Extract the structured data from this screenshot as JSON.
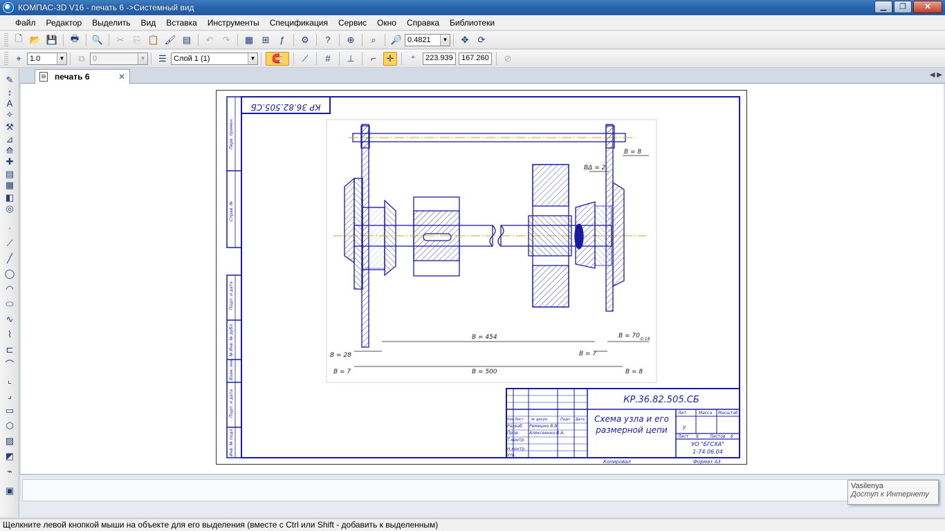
{
  "window": {
    "title": "КОМПАС-3D V16  - печать 6 ->Системный вид",
    "minimize": "▁",
    "maximize": "❐",
    "close": "✕"
  },
  "menu": [
    "Файл",
    "Редактор",
    "Выделить",
    "Вид",
    "Вставка",
    "Инструменты",
    "Спецификация",
    "Сервис",
    "Окно",
    "Справка",
    "Библиотеки"
  ],
  "toolbar1": {
    "zoom_value": "0.4821"
  },
  "toolbar2": {
    "line_scale": "1.0",
    "style_value": "0",
    "layer": "Слой 1 (1)",
    "coord_x": "223.939",
    "coord_y": "167.260"
  },
  "tab": {
    "label": "печать 6",
    "close": "✕",
    "scroll": "◀ ▶"
  },
  "drawing": {
    "stamp_top": "КР 36.82.505.СБ",
    "title_code": "КР.36.82.505.СБ",
    "title_name_line1": "Схема узла и его",
    "title_name_line2": "размерной цепи",
    "org_line1": "УО \"БГСХА\"",
    "org_line2": "1-74 06.04",
    "copied": "Копировал",
    "format": "Формат   А3",
    "lit": "Лит.",
    "mass": "Масса",
    "scale": "Масштаб",
    "sheet": "Лист",
    "sheets": "Листов",
    "sheet_num": "6",
    "sheets_num": "6",
    "lit_u": "у",
    "row_labels": [
      "Изм.",
      "Лист",
      "№ докум.",
      "Подп.",
      "Дата"
    ],
    "roles": [
      "Разраб.",
      "Пров.",
      "Т.контр.",
      "Н.контр.",
      "Утв."
    ],
    "developer": "Ремешко В.В.",
    "checker": "Алексеенко В.А.",
    "side_labels": [
      "Перв. примен.",
      "Справ. №",
      "Подп. и дата",
      "Инв. № дубл.",
      "Взам. инв. №",
      "Подп. и дата",
      "Инв. № подл."
    ],
    "dims": {
      "b_ku_8": "В = 8",
      "b_delta": "ВΔ = 2",
      "b_ku_28": "В = 28",
      "b_ku_7a": "В = 7",
      "b_ku_7b": "В = 7",
      "b_ku_454": "В = 454",
      "b_ku_500": "В = 500",
      "b_ku_70": "В = 70",
      "b_ku_8b": "В = 8",
      "sub_ku": "ш",
      "tol_70": "-0.18"
    }
  },
  "tooltip": {
    "user": "Vasilenya",
    "status": "Доступ к Интернету"
  },
  "status": "Щелкните левой кнопкой мыши на объекте для его выделения (вместе с Ctrl или Shift - добавить к выделенным)"
}
